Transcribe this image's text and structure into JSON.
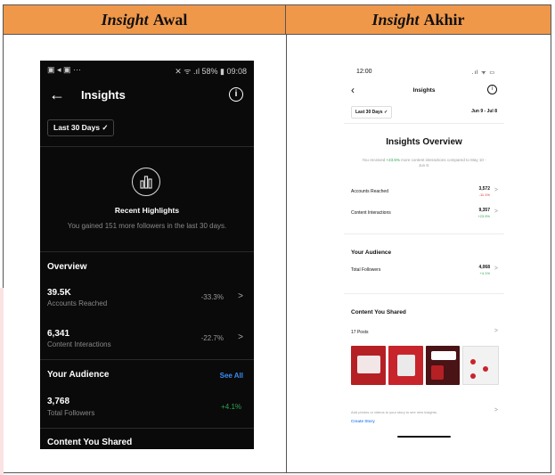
{
  "table": {
    "left_header": {
      "italic": "Insight",
      "rest": "Awal"
    },
    "right_header": {
      "italic": "Insight",
      "rest": "Akhir"
    }
  },
  "left_phone": {
    "status_left": "▣ ◂ ▣ ···",
    "status_right": "✕ ᯤ .ıl 58% ▮ 09:08",
    "title": "Insights",
    "date_filter": "Last 30 Days ✓",
    "highlights_title": "Recent Highlights",
    "highlights_text": "You gained 151 more followers in the last 30 days.",
    "overview_title": "Overview",
    "metrics": [
      {
        "value": "39.5K",
        "label": "Accounts Reached",
        "change": "-33.3%"
      },
      {
        "value": "6,341",
        "label": "Content Interactions",
        "change": "-22.7%"
      }
    ],
    "audience_title": "Your Audience",
    "see_all": "See All",
    "followers": {
      "value": "3,768",
      "label": "Total Followers",
      "change": "+4.1%"
    },
    "content_title": "Content You Shared"
  },
  "right_phone": {
    "time": "12:00",
    "status_icons": ".ıl ᯤ ▭",
    "title": "Insights",
    "date_filter": "Last 30 Days ✓",
    "date_range": "Jun 9 - Jul 8",
    "overview_title": "Insights Overview",
    "overview_sub_pre": "You received ",
    "overview_sub_highlight": "+23.5%",
    "overview_sub_post": " more content interactions compared to May 10 - Jun 8.",
    "rows": [
      {
        "label": "Accounts Reached",
        "value": "3,572",
        "change": "-11.1%"
      },
      {
        "label": "Content Interactions",
        "value": "9,357",
        "change": "+23.5%"
      }
    ],
    "audience_title": "Your Audience",
    "followers": {
      "label": "Total Followers",
      "value": "4,068",
      "change": "+4.1%"
    },
    "content_title": "Content You Shared",
    "posts": "17 Posts",
    "add_text": "Add photos or videos to your story to see new insights.",
    "create_story": "Create Story",
    "thumb_colors": [
      "#b52025",
      "#c8242c",
      "#6e1b1f",
      "#f2f2f2"
    ]
  }
}
